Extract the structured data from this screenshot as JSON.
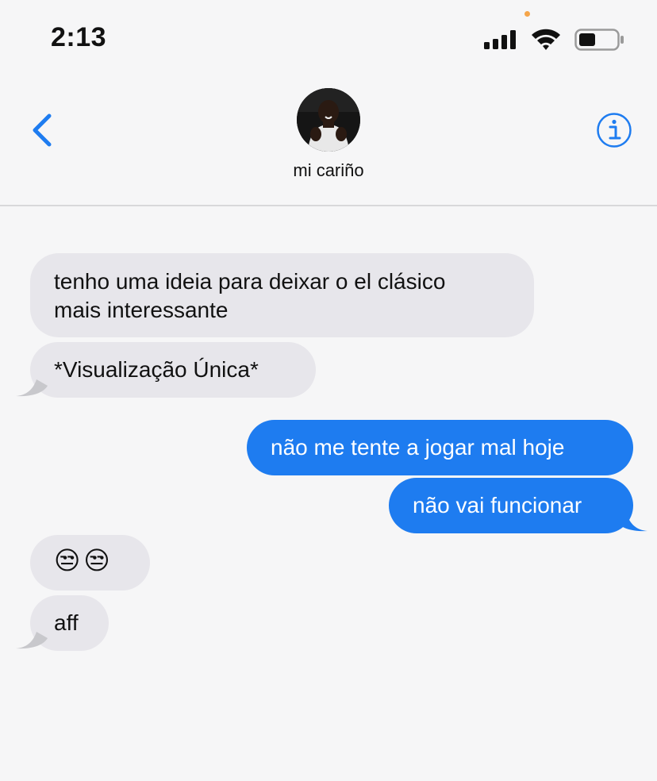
{
  "status_bar": {
    "time": "2:13"
  },
  "header": {
    "contact_name": "mi cariño",
    "back_icon": "chevron-left-icon",
    "info_icon": "info-icon",
    "accent_color": "#1e7cf0"
  },
  "messages": [
    {
      "direction": "incoming",
      "text": "tenho uma ideia para deixar o el clásico\nmais interessante"
    },
    {
      "direction": "incoming",
      "text": "*Visualização Única*"
    },
    {
      "direction": "outgoing",
      "text": "não me tente a jogar mal hoje"
    },
    {
      "direction": "outgoing",
      "text": "não vai funcionar"
    },
    {
      "direction": "incoming",
      "text": "😒😒"
    },
    {
      "direction": "incoming",
      "text": "aff"
    }
  ],
  "colors": {
    "incoming_bubble": "#e7e6eb",
    "outgoing_bubble": "#1e7cf0",
    "background": "#f6f6f7"
  }
}
